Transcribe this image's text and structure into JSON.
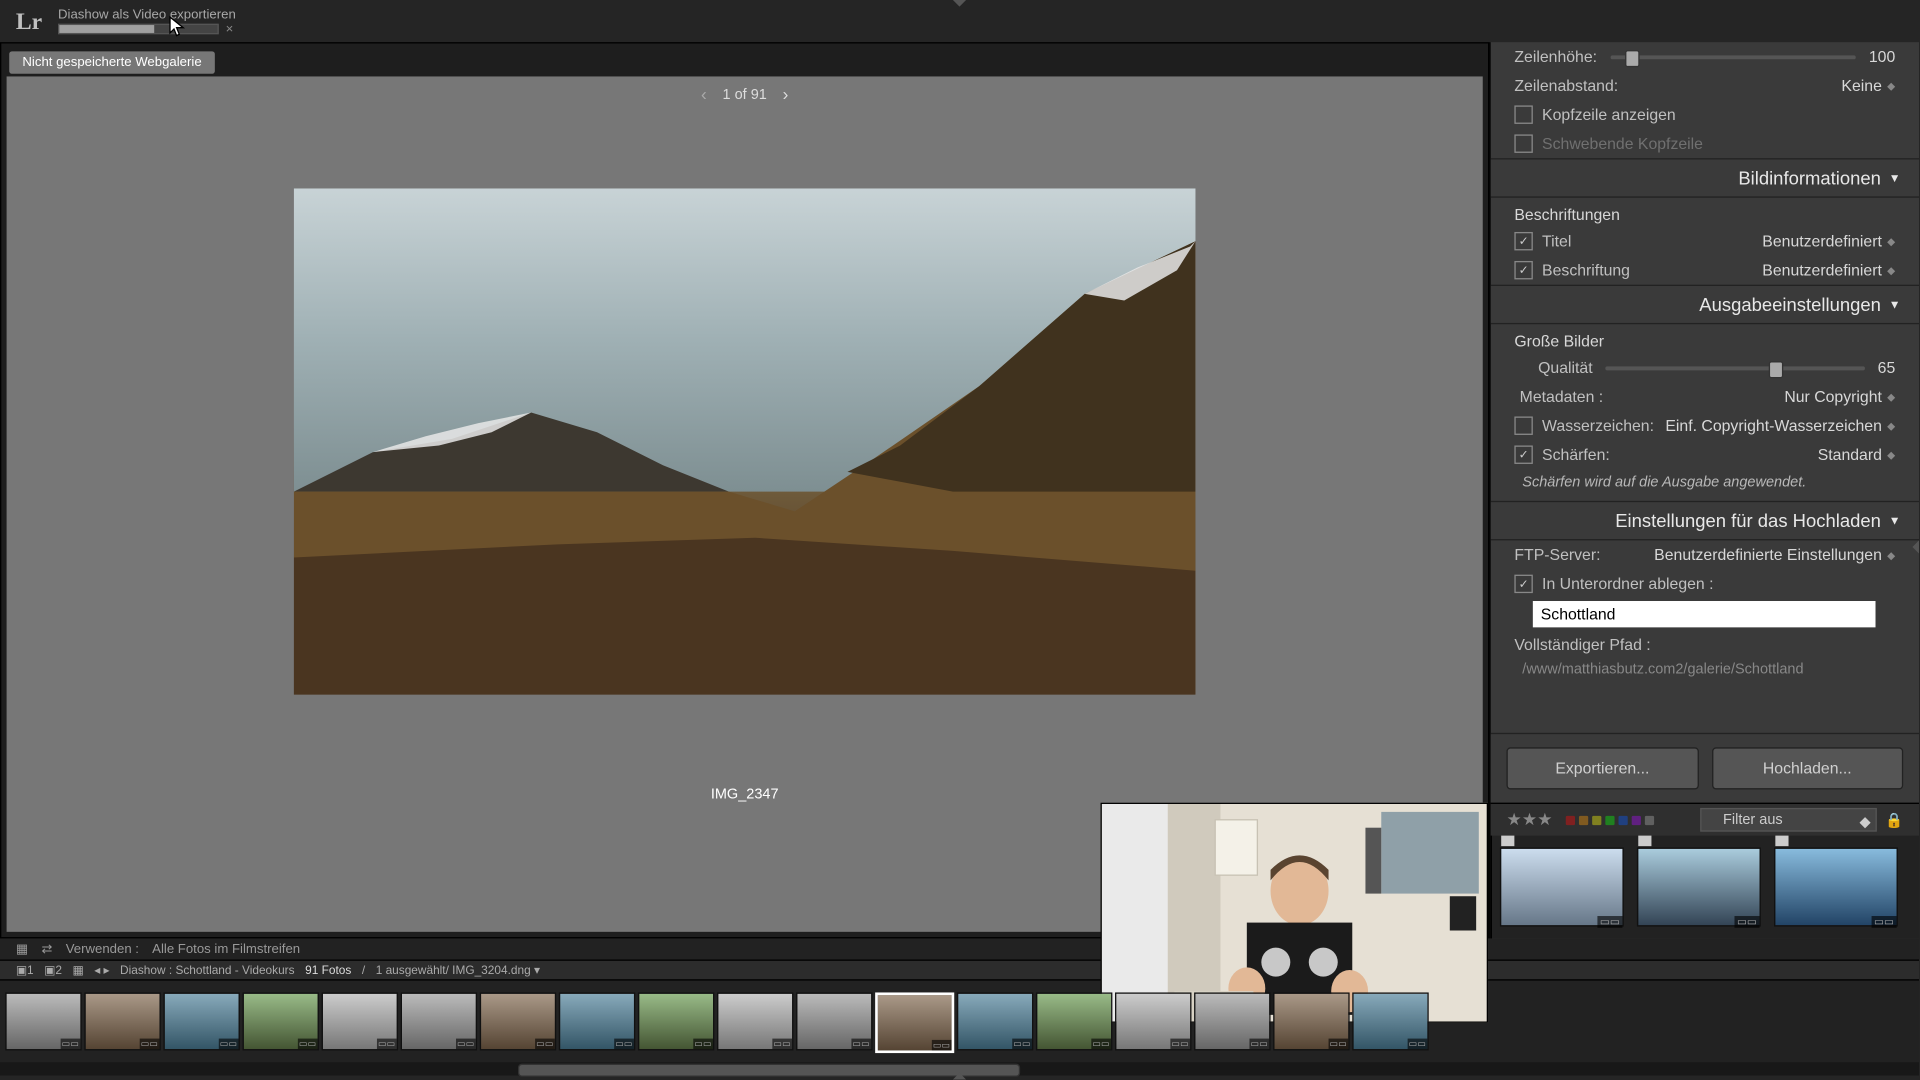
{
  "app": {
    "logo": "Lr",
    "task_title": "Diashow als Video exportieren",
    "task_progress_pct": 60
  },
  "gallery": {
    "unsaved_title": "Nicht gespeicherte Webgalerie",
    "nav_text": "1 of 91",
    "caption": "IMG_2347"
  },
  "panel": {
    "row_height": {
      "label": "Zeilenhöhe:",
      "value": "100",
      "pct": 6
    },
    "row_spacing": {
      "label": "Zeilenabstand:",
      "value": "Keine"
    },
    "show_header": {
      "label": "Kopfzeile anzeigen"
    },
    "floating_header": {
      "label": "Schwebende Kopfzeile"
    },
    "section_info": "Bildinformationen",
    "captions_sub": "Beschriftungen",
    "title": {
      "label": "Titel",
      "value": "Benutzerdefiniert"
    },
    "caption": {
      "label": "Beschriftung",
      "value": "Benutzerdefiniert"
    },
    "section_output": "Ausgabeeinstellungen",
    "large_images": "Große Bilder",
    "quality": {
      "label": "Qualität",
      "value": "65",
      "pct": 63
    },
    "metadata": {
      "label": "Metadaten :",
      "value": "Nur Copyright"
    },
    "watermark": {
      "label": "Wasserzeichen:",
      "value": "Einf. Copyright-Wasserzeichen"
    },
    "sharpen": {
      "label": "Schärfen:",
      "value": "Standard"
    },
    "sharpen_note": "Schärfen wird auf die Ausgabe angewendet.",
    "section_upload": "Einstellungen für das Hochladen",
    "ftp": {
      "label": "FTP-Server:",
      "value": "Benutzerdefinierte Einstellungen"
    },
    "subfolder": {
      "label": "In Unterordner ablegen :",
      "value": "Schottland"
    },
    "fullpath": {
      "label": "Vollständiger Pfad :",
      "value": "/www/matthiasbutz.com2/galerie/Schottland"
    },
    "btn_export": "Exportieren...",
    "btn_upload": "Hochladen..."
  },
  "filter": {
    "label": "Filter aus",
    "colors": [
      "#802020",
      "#805a20",
      "#808020",
      "#208020",
      "#204080",
      "#602080",
      "#606060"
    ]
  },
  "status": {
    "use_label": "Verwenden :",
    "use_value": "Alle Fotos im Filmstreifen"
  },
  "breadcrumb": {
    "path": "Diashow : Schottland - Videokurs",
    "count": "91 Fotos",
    "selection": "1 ausgewählt/ IMG_3204.dng ▾"
  },
  "filmstrip": {
    "selected_index": 11,
    "thumbs": [
      0,
      1,
      2,
      3,
      4,
      5,
      6,
      7,
      8,
      9,
      10,
      11,
      12,
      13,
      14,
      15,
      16,
      17
    ],
    "scroll_left_pct": 27,
    "scroll_width_pct": 26
  }
}
